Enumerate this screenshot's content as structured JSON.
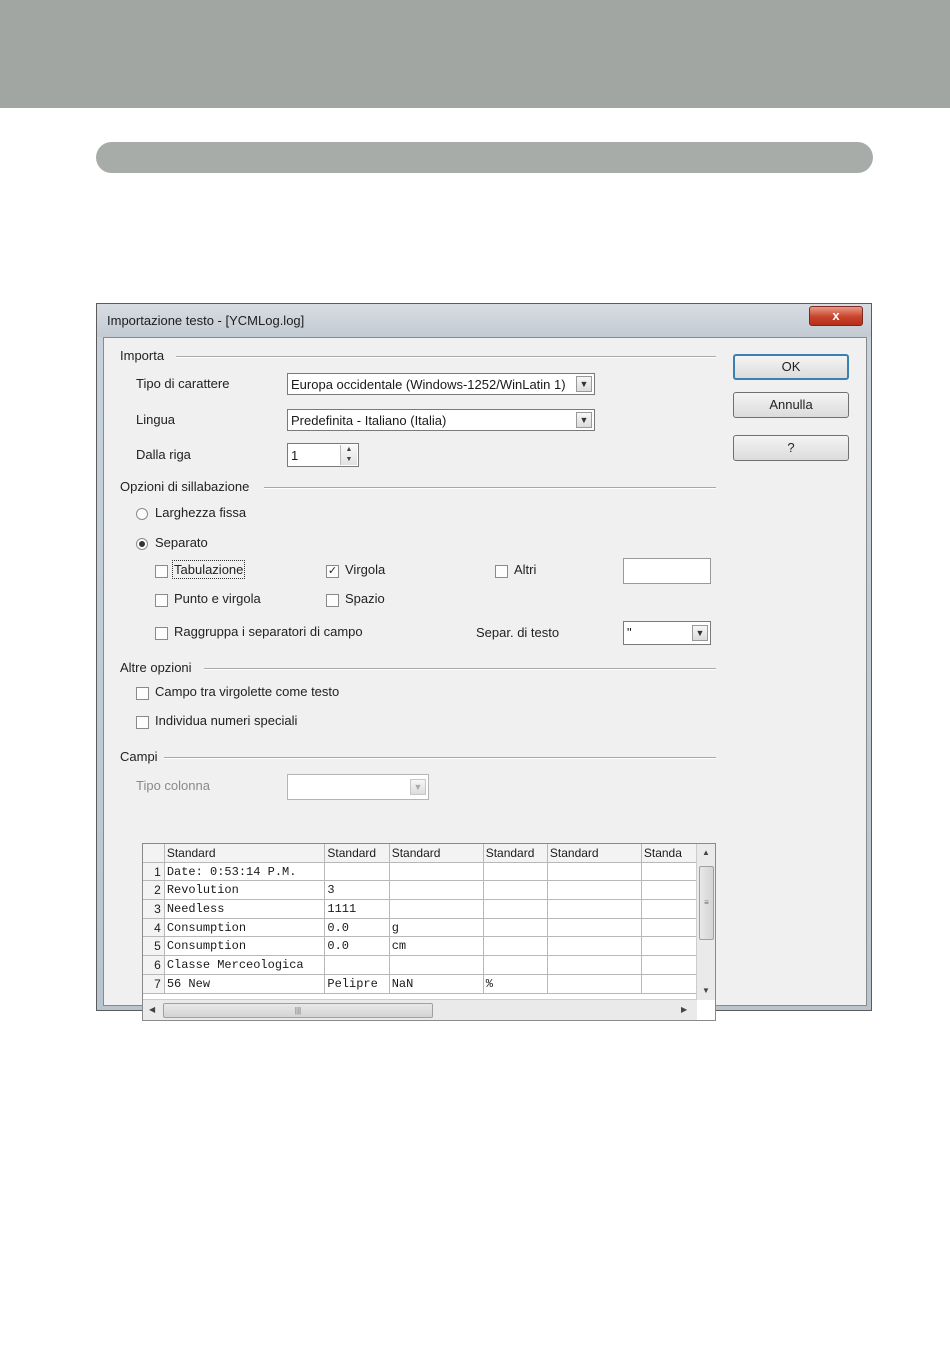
{
  "dialog": {
    "title": "Importazione testo - [YCMLog.log]",
    "close_label": "x"
  },
  "buttons": {
    "ok": "OK",
    "cancel": "Annulla",
    "help": "?"
  },
  "import": {
    "section": "Importa",
    "charset_label": "Tipo di carattere",
    "charset_value": "Europa occidentale (Windows-1252/WinLatin 1)",
    "language_label": "Lingua",
    "language_value": "Predefinita - Italiano (Italia)",
    "from_row_label": "Dalla riga",
    "from_row_value": "1"
  },
  "separator_options": {
    "section": "Opzioni di sillabazione",
    "fixed_width": "Larghezza fissa",
    "separated": "Separato",
    "tab": "Tabulazione",
    "comma": "Virgola",
    "other": "Altri",
    "semicolon": "Punto e virgola",
    "space": "Spazio",
    "merge": "Raggruppa i separatori di campo",
    "text_delimiter_label": "Separ. di testo",
    "text_delimiter_value": "\""
  },
  "other_options": {
    "section": "Altre opzioni",
    "quoted_as_text": "Campo tra virgolette come testo",
    "detect_special": "Individua numeri speciali"
  },
  "fields": {
    "section": "Campi",
    "column_type_label": "Tipo colonna",
    "headers": [
      "Standard",
      "Standard",
      "Standard",
      "Standard",
      "Standard",
      "Standa"
    ],
    "rows": [
      {
        "n": "1",
        "c": [
          "Date: 0:53:14 P.M.",
          "",
          "",
          "",
          "",
          ""
        ]
      },
      {
        "n": "2",
        "c": [
          "Revolution",
          "3",
          "",
          "",
          "",
          ""
        ]
      },
      {
        "n": "3",
        "c": [
          "Needless",
          "1111",
          "",
          "",
          "",
          ""
        ]
      },
      {
        "n": "4",
        "c": [
          "Consumption",
          "0.0",
          "g",
          "",
          "",
          ""
        ]
      },
      {
        "n": "5",
        "c": [
          "Consumption",
          "0.0",
          "cm",
          "",
          "",
          ""
        ]
      },
      {
        "n": "6",
        "c": [
          "Classe Merceologica",
          "",
          "",
          "",
          "",
          ""
        ]
      },
      {
        "n": "7",
        "c": [
          "56 New",
          "Pelipre",
          "NaN",
          "%",
          "",
          ""
        ]
      }
    ]
  }
}
